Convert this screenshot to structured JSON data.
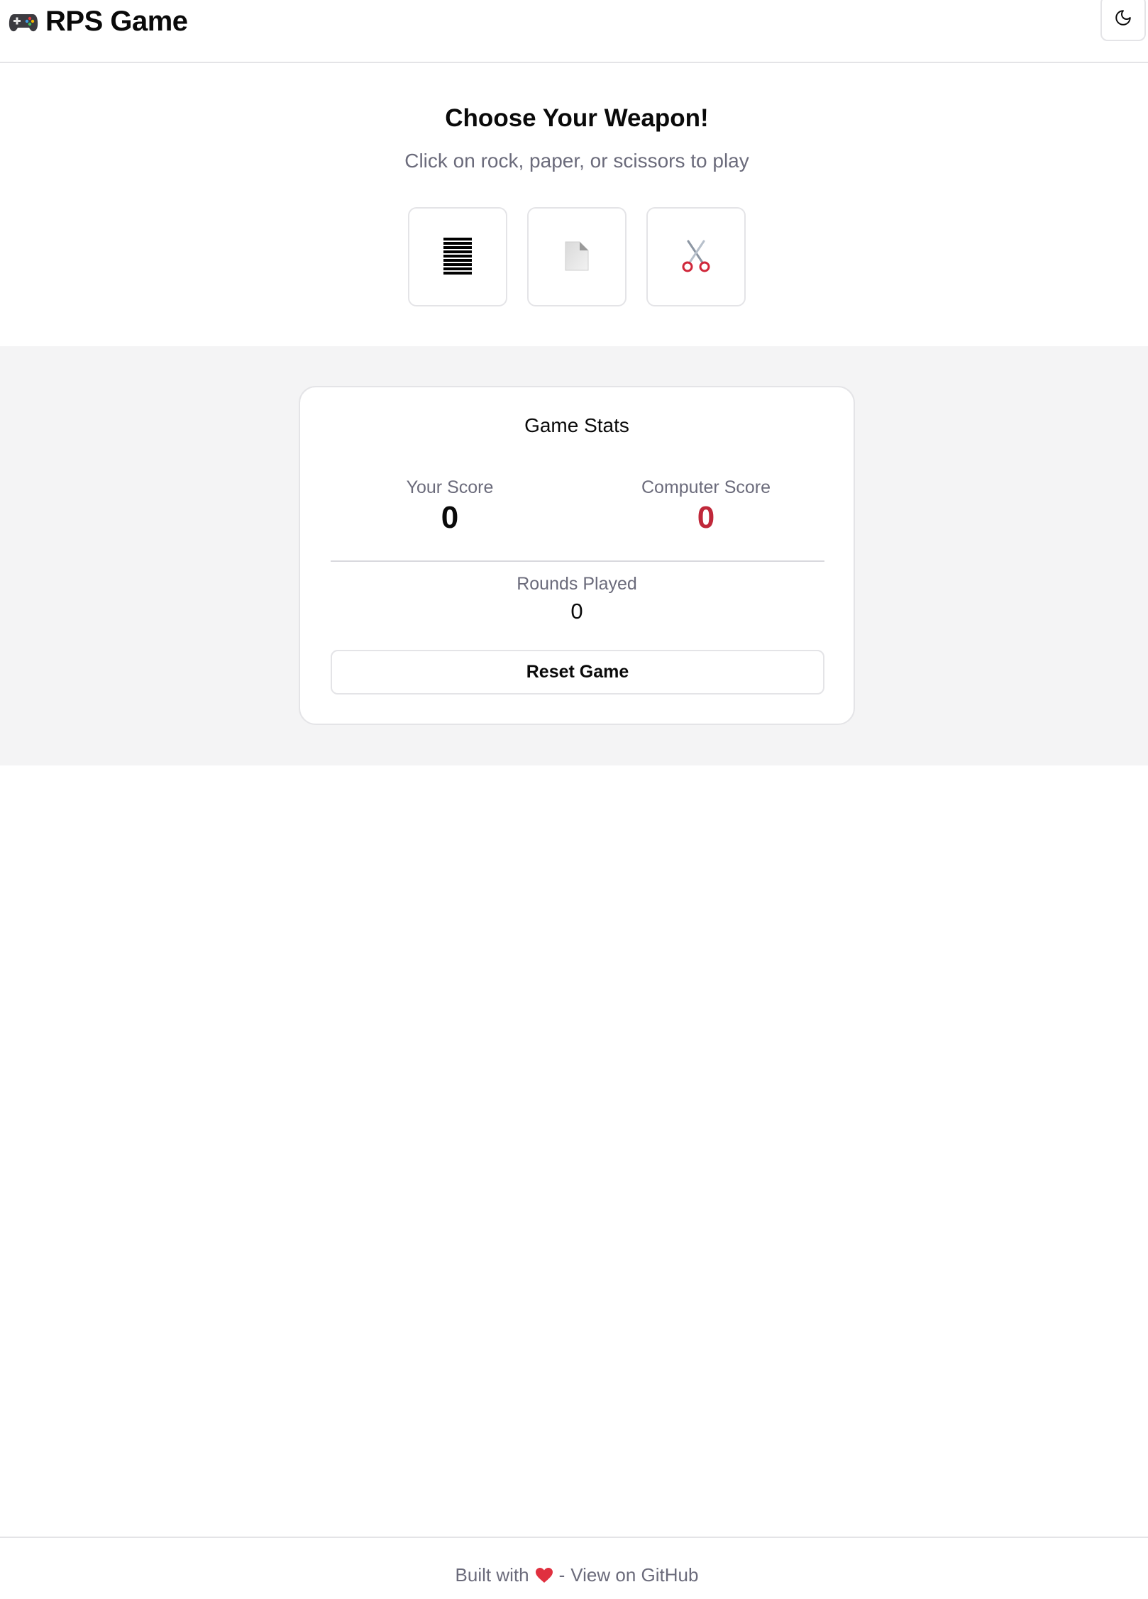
{
  "header": {
    "title": "RPS Game",
    "logo_icon": "gamepad-icon",
    "theme_toggle_icon": "moon-icon"
  },
  "hero": {
    "title": "Choose Your Weapon!",
    "subtitle": "Click on rock, paper, or scissors to play",
    "weapons": [
      {
        "name": "rock",
        "icon": "rock-icon"
      },
      {
        "name": "paper",
        "icon": "paper-icon"
      },
      {
        "name": "scissors",
        "icon": "scissors-icon"
      }
    ]
  },
  "stats": {
    "title": "Game Stats",
    "your_score_label": "Your Score",
    "your_score": "0",
    "computer_score_label": "Computer Score",
    "computer_score": "0",
    "rounds_label": "Rounds Played",
    "rounds": "0",
    "reset_label": "Reset Game"
  },
  "footer": {
    "built_with": "Built with",
    "separator": "-",
    "github_link": "View on GitHub",
    "heart_icon": "heart-icon"
  },
  "colors": {
    "computer_score": "#c0283a",
    "muted_text": "#6b6b7b",
    "border": "#e4e4e7",
    "stats_background": "#f4f4f5"
  }
}
